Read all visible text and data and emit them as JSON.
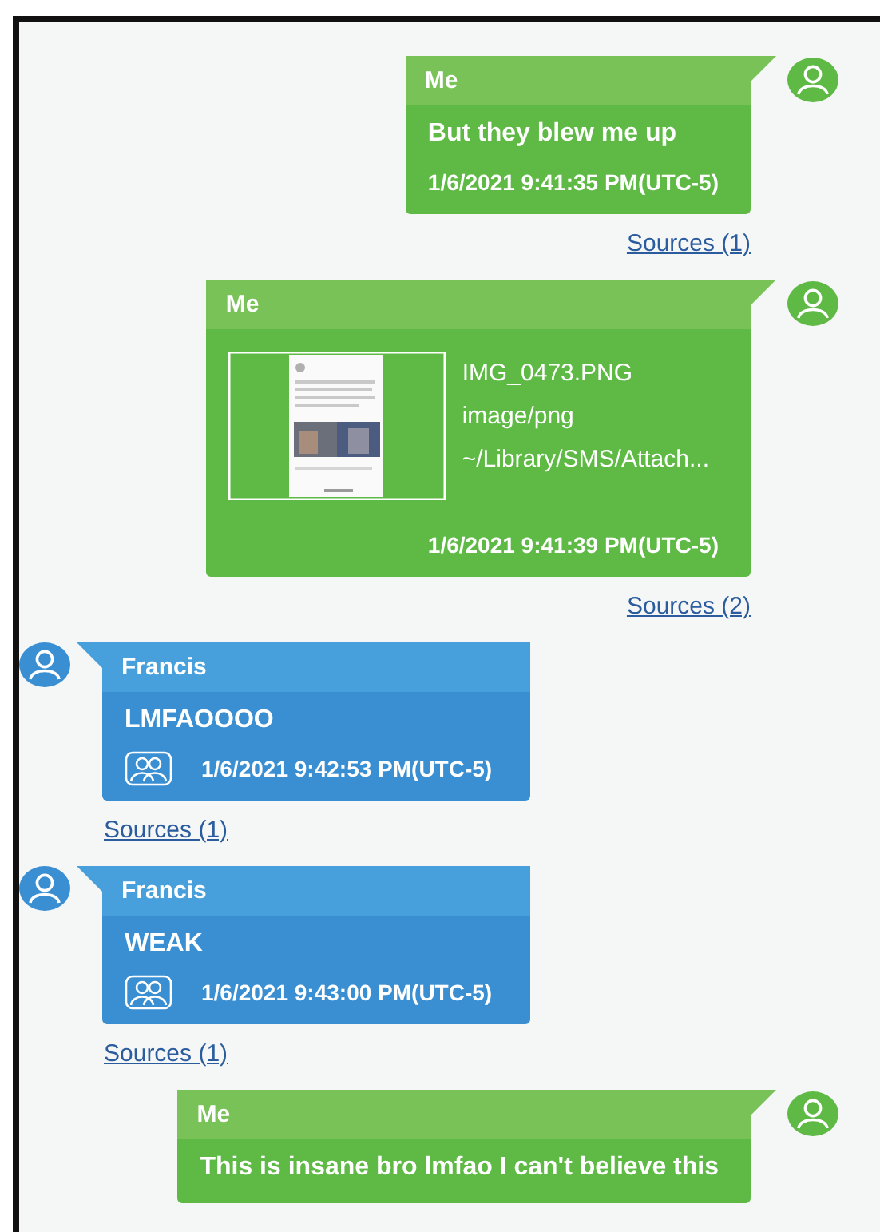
{
  "messages": [
    {
      "kind": "outgoing",
      "sender": "Me",
      "text": "But they blew me up",
      "timestamp": "1/6/2021 9:41:35 PM(UTC-5)",
      "sources": "Sources (1)"
    },
    {
      "kind": "outgoing",
      "sender": "Me",
      "attachment": {
        "name": "IMG_0473.PNG",
        "type": "image/png",
        "path": "~/Library/SMS/Attach..."
      },
      "timestamp": "1/6/2021 9:41:39 PM(UTC-5)",
      "sources": "Sources (2)"
    },
    {
      "kind": "incoming",
      "sender": "Francis",
      "text": "LMFAOOOO",
      "timestamp": "1/6/2021 9:42:53 PM(UTC-5)",
      "sources": "Sources (1)"
    },
    {
      "kind": "incoming",
      "sender": "Francis",
      "text": "WEAK",
      "timestamp": "1/6/2021 9:43:00 PM(UTC-5)",
      "sources": "Sources (1)"
    },
    {
      "kind": "outgoing",
      "sender": "Me",
      "text": "This is insane bro lmfao I can't believe this"
    }
  ]
}
